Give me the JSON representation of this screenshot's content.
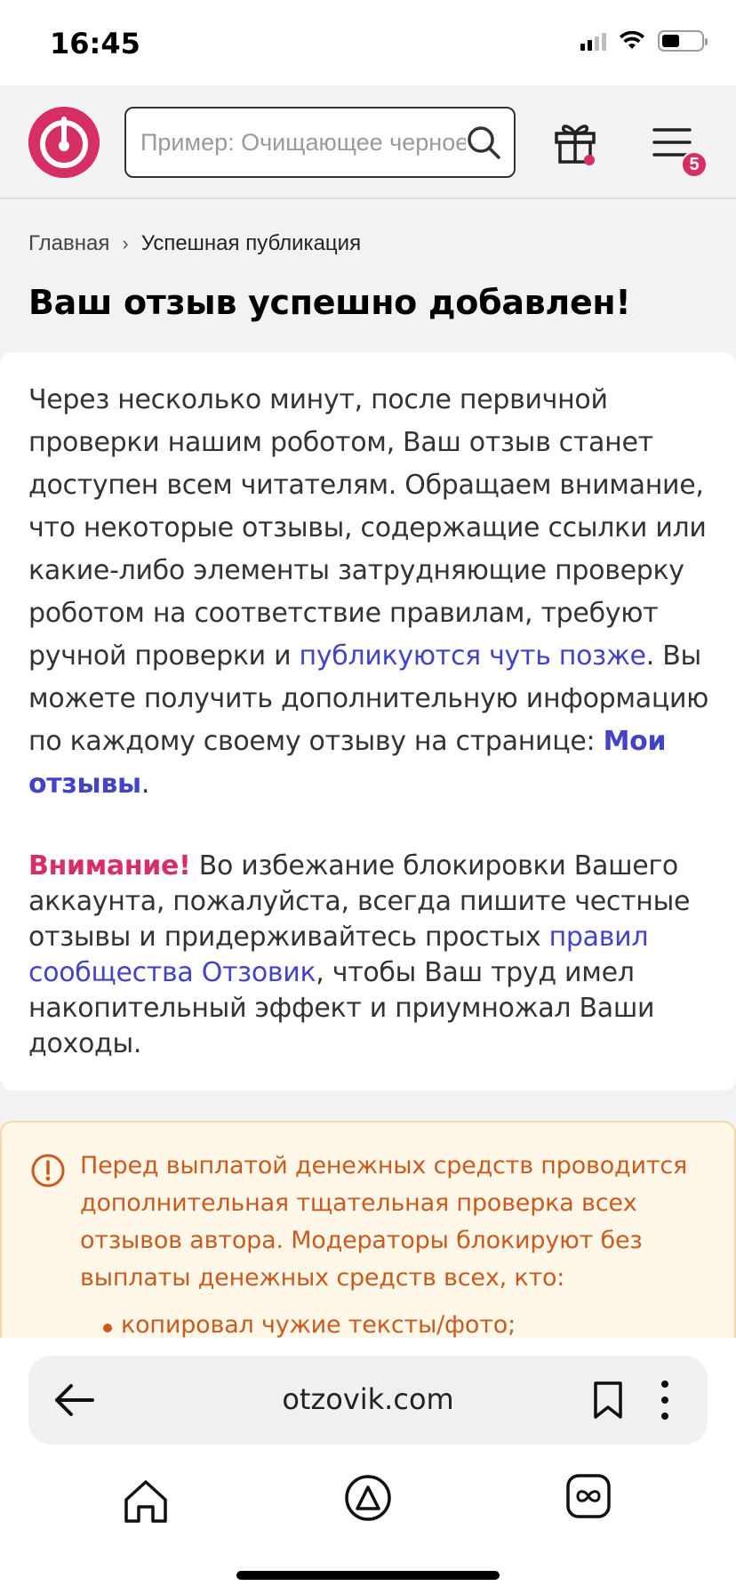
{
  "status_bar": {
    "time": "16:45"
  },
  "header": {
    "search_placeholder": "Пример: Очищающее черное мыло",
    "menu_badge": "5"
  },
  "breadcrumb": {
    "home": "Главная",
    "separator": "›",
    "current": "Успешная публикация"
  },
  "page_title": "Ваш отзыв успешно добавлен!",
  "card": {
    "text_1": "Через несколько минут, после первичной проверки нашим роботом, Ваш отзыв станет доступен всем читателям. Обращаем внимание, что некоторые отзывы, содержащие ссылки или какие-либо элементы затрудняющие проверку роботом на соответствие правилам, требуют ручной проверки и ",
    "link_later": "публикуются чуть позже",
    "text_2": ". Вы можете получить дополнительную информацию по каждому своему отзыву на странице: ",
    "link_my_reviews": "Мои отзывы",
    "text_3": ".",
    "notice_label": "Внимание!",
    "notice_text_1": " Во избежание блокировки Вашего аккаунта, пожалуйста, всегда пишите честные отзывы и придерживайтесь простых ",
    "link_rules": "правил сообщества Отзовик",
    "notice_text_2": ", чтобы Ваш труд имел накопительный эффект и приумножал Ваши доходы."
  },
  "warning": {
    "text": "Перед выплатой денежных средств проводится дополнительная тщательная проверка всех отзывов автора. Модераторы блокируют без выплаты денежных средств всех, кто:",
    "bullet_1": "копировал чужие тексты/фото;"
  },
  "browser": {
    "url": "otzovik.com"
  },
  "colors": {
    "brand": "#d62f63",
    "link": "#4343c8",
    "warning": "#cc5a1e",
    "warning_bg": "#fff8e8"
  }
}
